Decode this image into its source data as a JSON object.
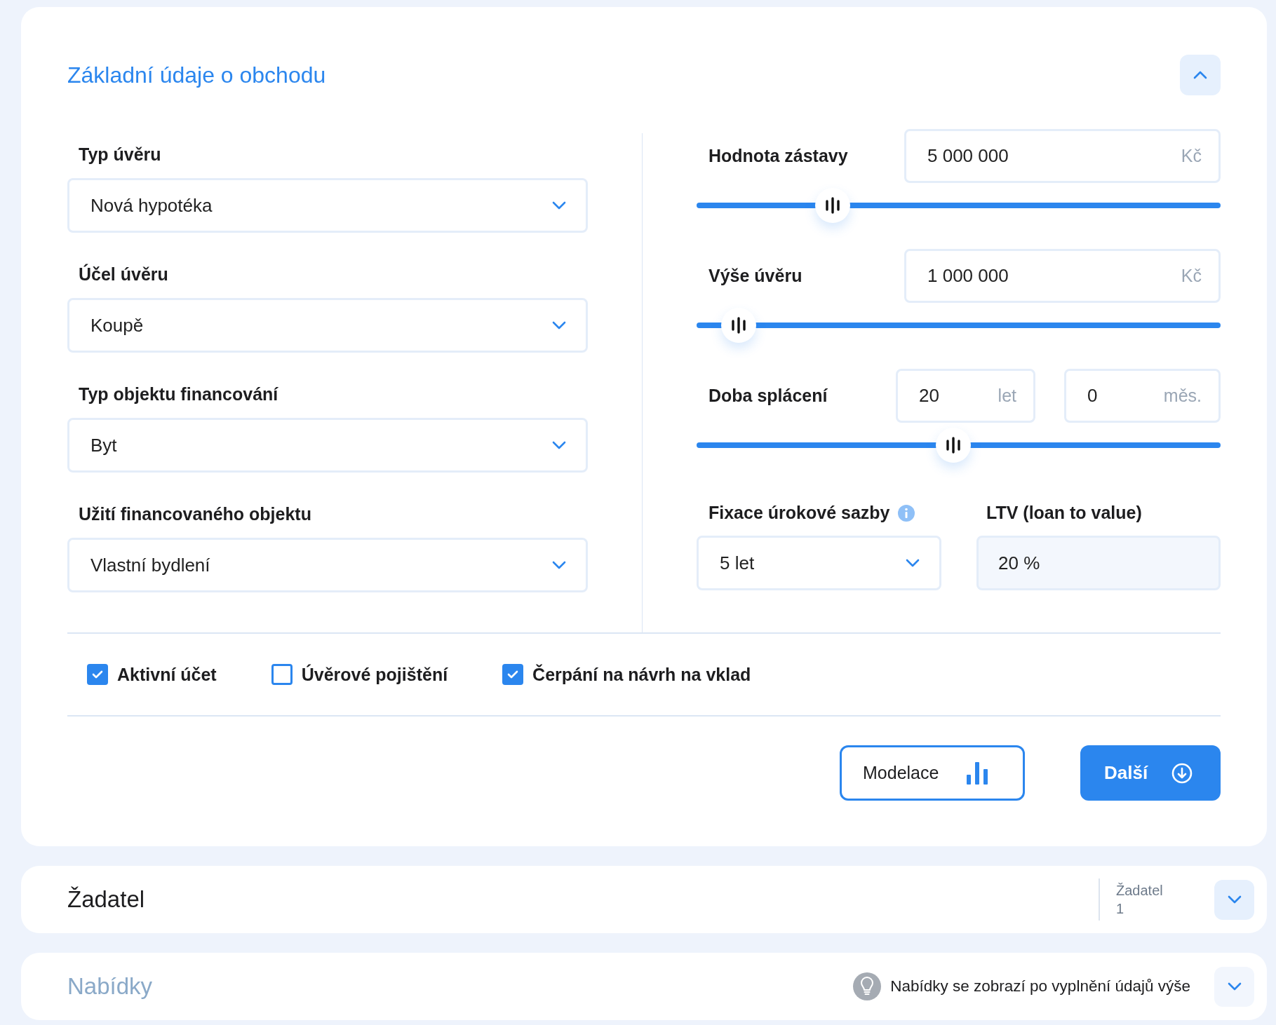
{
  "section": {
    "title": "Základní údaje o obchodu",
    "expanded": true
  },
  "selects": [
    {
      "label": "Typ úvěru",
      "value": "Nová hypotéka"
    },
    {
      "label": "Účel úvěru",
      "value": "Koupě"
    },
    {
      "label": "Typ objektu financování",
      "value": "Byt"
    },
    {
      "label": "Užití financovaného objektu",
      "value": "Vlastní bydlení"
    }
  ],
  "amounts": [
    {
      "label": "Hodnota zástavy",
      "value": "5 000 000",
      "unit": "Kč",
      "level": 0.26
    },
    {
      "label": "Výše úvěru",
      "value": "1 000 000",
      "unit": "Kč",
      "level": 0.08
    }
  ],
  "term": {
    "label": "Doba splácení",
    "years": "20",
    "years_unit": "let",
    "months": "0",
    "months_unit": "měs.",
    "level": 0.49
  },
  "fixation": {
    "label": "Fixace úrokové sazby",
    "value": "5 let"
  },
  "ltv": {
    "label": "LTV (loan to value)",
    "value": "20 %"
  },
  "checkboxes": [
    {
      "label": "Aktivní účet",
      "checked": true
    },
    {
      "label": "Úvěrové pojištění",
      "checked": false
    },
    {
      "label": "Čerpání na návrh na vklad",
      "checked": true
    }
  ],
  "buttons": [
    {
      "kind": "outline",
      "label": "Modelace"
    },
    {
      "kind": "primary",
      "label": "Další"
    }
  ],
  "applicant": {
    "title": "Žadatel",
    "meta_label": "Žadatel",
    "meta_value": "1",
    "expanded": false
  },
  "offers": {
    "title": "Nabídky",
    "hint": "Nabídky se zobrazí po vyplnění údajů výše",
    "disabled": true,
    "expanded": false
  }
}
